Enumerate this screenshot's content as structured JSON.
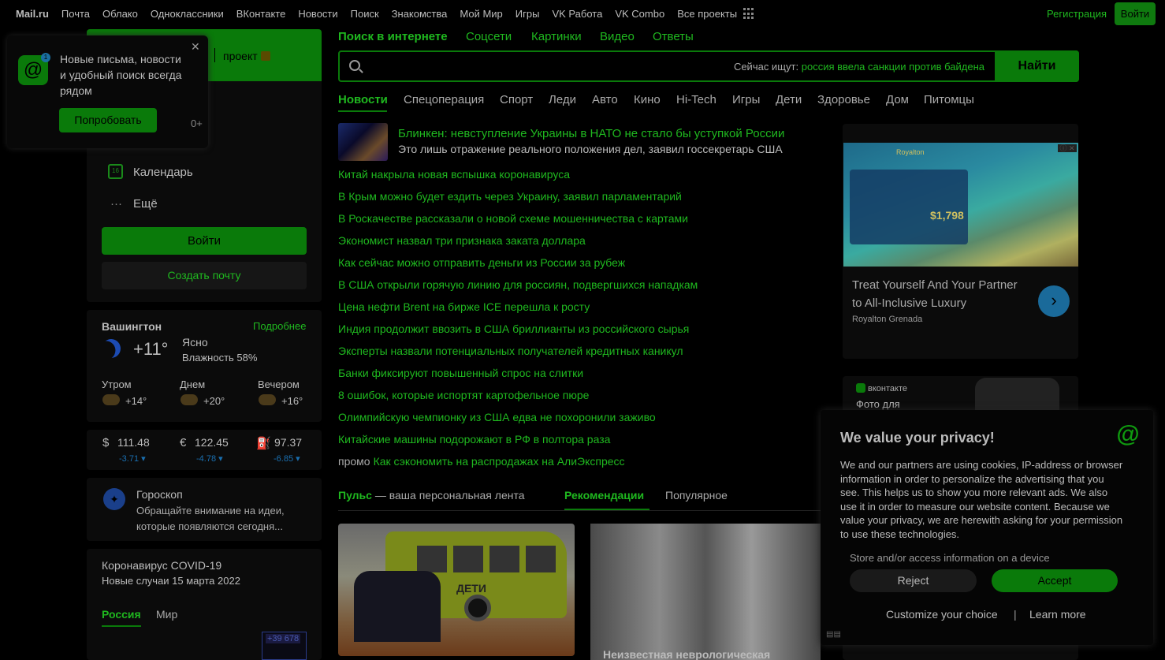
{
  "topnav": {
    "links": [
      "Mail.ru",
      "Почта",
      "Облако",
      "Одноклассники",
      "ВКонтакте",
      "Новости",
      "Поиск",
      "Знакомства",
      "Мой Мир",
      "Игры",
      "VK Работа",
      "VK Combo",
      "Все проекты"
    ],
    "register": "Регистрация",
    "login": "Войти"
  },
  "left": {
    "project": "проект",
    "popup": {
      "text": "Новые письма, новости и удобный поиск всегда рядом",
      "button": "Попробовать",
      "count": "0+",
      "close": "✕"
    },
    "menu": [
      "Календарь",
      "Ещё"
    ],
    "login_button": "Войти",
    "create_button": "Создать почту",
    "weather": {
      "city": "Вашингтон",
      "more": "Подробнее",
      "temp": "+11°",
      "condition": "Ясно",
      "humidity": "Влажность 58%",
      "parts": [
        {
          "label": "Утром",
          "temp": "+14°"
        },
        {
          "label": "Днем",
          "temp": "+20°"
        },
        {
          "label": "Вечером",
          "temp": "+16°"
        }
      ]
    },
    "rates": [
      {
        "symbol": "$",
        "value": "111.48",
        "change": "-3.71 ▾"
      },
      {
        "symbol": "€",
        "value": "122.45",
        "change": "-4.78 ▾"
      },
      {
        "symbol": "⛽",
        "value": "97.37",
        "change": "-6.85 ▾"
      }
    ],
    "horoscope": {
      "title": "Гороскоп",
      "text": "Обращайте внимание на идеи, которые появляются сегодня..."
    },
    "covid": {
      "title": "Коронавирус COVID-19",
      "subtitle": "Новые случаи 15 марта 2022",
      "tabs": [
        "Россия",
        "Мир"
      ],
      "badge": "+39 678"
    }
  },
  "search": {
    "tabs": [
      "Поиск в интернете",
      "Соцсети",
      "Картинки",
      "Видео",
      "Ответы"
    ],
    "hint_prefix": "Сейчас ищут:",
    "hint_query": "россия ввела санкции против байдена",
    "button": "Найти"
  },
  "categories": [
    "Новости",
    "Спецоперация",
    "Спорт",
    "Леди",
    "Авто",
    "Кино",
    "Hi-Tech",
    "Игры",
    "Дети",
    "Здоровье",
    "Дом",
    "Питомцы"
  ],
  "lead": {
    "title": "Блинкен: невступление Украины в НАТО не стало бы уступкой России",
    "subtitle": "Это лишь отражение реального положения дел, заявил госсекретарь США"
  },
  "news": [
    "Китай накрыла новая вспышка коронавируса",
    "В Крым можно будет ездить через Украину, заявил парламентарий",
    "В Роскачестве рассказали о новой схеме мошенничества с картами",
    "Экономист назвал три признака заката доллара",
    "Как сейчас можно отправить деньги из России за рубеж",
    "В США открыли горячую линию для россиян, подвергшихся нападкам",
    "Цена нефти Brent на бирже ICE перешла к росту",
    "Индия продолжит ввозить в США бриллианты из российского сырья",
    "Эксперты назвали потенциальных получателей кредитных каникул",
    "Банки фиксируют повышенный спрос на слитки",
    "8 ошибок, которые испортят картофельное пюре",
    "Олимпийскую чемпионку из США едва не похоронили заживо",
    "Китайские машины подорожают в РФ в полтора раза"
  ],
  "promo": {
    "tag": "промо",
    "text": "Как сэкономить на распродажах на АлиЭкспресс"
  },
  "feed": {
    "pulse": "Пульс",
    "pulse_rest": " — ваша персональная лента",
    "rec": "Рекомендации",
    "popular": "Популярное",
    "bus_sign": "ДЕТИ",
    "card2_caption": "Неизвестная неврологическая"
  },
  "ad": {
    "title": "Treat Yourself And Your Partner to All-Inclusive Luxury",
    "brand": "Royalton Grenada",
    "logo": "Royalton",
    "price": "$1,798",
    "x": "ⓘ ✕",
    "arrow": "›"
  },
  "vk": {
    "logo": "вконтакте",
    "text": "Фото для"
  },
  "privacy": {
    "heading": "We value your privacy!",
    "body": "We and our partners are using cookies, IP-address or browser information in order to personalize the advertising that you see. This helps us to show you more relevant ads. We also use it in order to measure our website content. Because we value your privacy, we are herewith asking for your permission to use these technologies.",
    "store": "Store and/or access information on a device",
    "reject": "Reject",
    "accept": "Accept",
    "customize": "Customize your choice",
    "sep": "|",
    "learn": "Learn more"
  }
}
